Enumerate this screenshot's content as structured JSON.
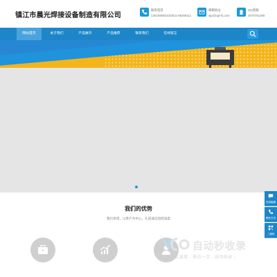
{
  "header": {
    "company": "镇江市晨光焊接设备制造有限公司",
    "contacts": [
      {
        "icon": "phone-icon",
        "label": "联系电话",
        "value": "13016858310(0511-86208111"
      },
      {
        "icon": "email-icon",
        "label": "邮箱地址",
        "value": "wjx@cgl-hj.com"
      },
      {
        "icon": "qq-icon",
        "label": "QQ客服",
        "value": "2076751305"
      }
    ]
  },
  "nav": {
    "items": [
      "网站首页",
      "关于我们",
      "产品展示",
      "产品推荐",
      "联系我们",
      "在线留言"
    ],
    "active_index": 0
  },
  "slider": {
    "active_dot": 1,
    "dot_color": "#1c9ad6"
  },
  "advantages": {
    "title": "我们的优势",
    "subtitle": "我们承诺，以客户为中心，礼成诚信团结诚度",
    "icons": [
      "briefcase-icon",
      "chart-growth-icon",
      "person-icon"
    ]
  },
  "watermark": {
    "title": "自动秒收录",
    "tagline": "→上链接→来访一次→自动收录→"
  },
  "float_bar": {
    "items": [
      {
        "icon": "chat-icon",
        "label": "在线客服"
      },
      {
        "icon": "phone-icon",
        "label": "联系方式"
      },
      {
        "icon": "qrcode-icon",
        "label": "二维码"
      }
    ]
  },
  "colors": {
    "brand_blue": "#1c86c9",
    "accent_blue": "#1c9ad6",
    "banner_yellow": "#f3b51b",
    "slide_gray": "#e5e5e5"
  }
}
